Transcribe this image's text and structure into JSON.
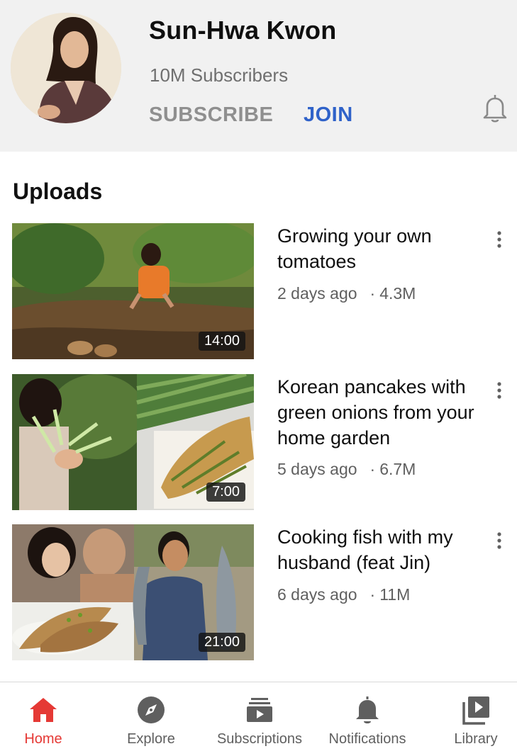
{
  "channel": {
    "name": "Sun-Hwa Kwon",
    "subscribers": "10M Subscribers",
    "subscribe_label": "SUBSCRIBE",
    "join_label": "JOIN"
  },
  "uploads": {
    "title": "Uploads",
    "videos": [
      {
        "title": "Growing your own tomatoes",
        "age": "2 days ago",
        "views": "4.3M",
        "duration": "14:00"
      },
      {
        "title": "Korean pancakes with green onions from your home garden",
        "age": "5 days ago",
        "views": "6.7M",
        "duration": "7:00"
      },
      {
        "title": "Cooking fish with my husband (feat Jin)",
        "age": "6 days ago",
        "views": "11M",
        "duration": "21:00"
      }
    ]
  },
  "nav": {
    "items": [
      {
        "label": "Home",
        "icon": "home-icon",
        "active": true
      },
      {
        "label": "Explore",
        "icon": "compass-icon",
        "active": false
      },
      {
        "label": "Subscriptions",
        "icon": "subscriptions-icon",
        "active": false
      },
      {
        "label": "Notifications",
        "icon": "bell-icon",
        "active": false
      },
      {
        "label": "Library",
        "icon": "library-icon",
        "active": false
      }
    ]
  },
  "colors": {
    "accent": "#e53935",
    "join": "#2f62c9",
    "header_bg": "#f1f1f1"
  }
}
